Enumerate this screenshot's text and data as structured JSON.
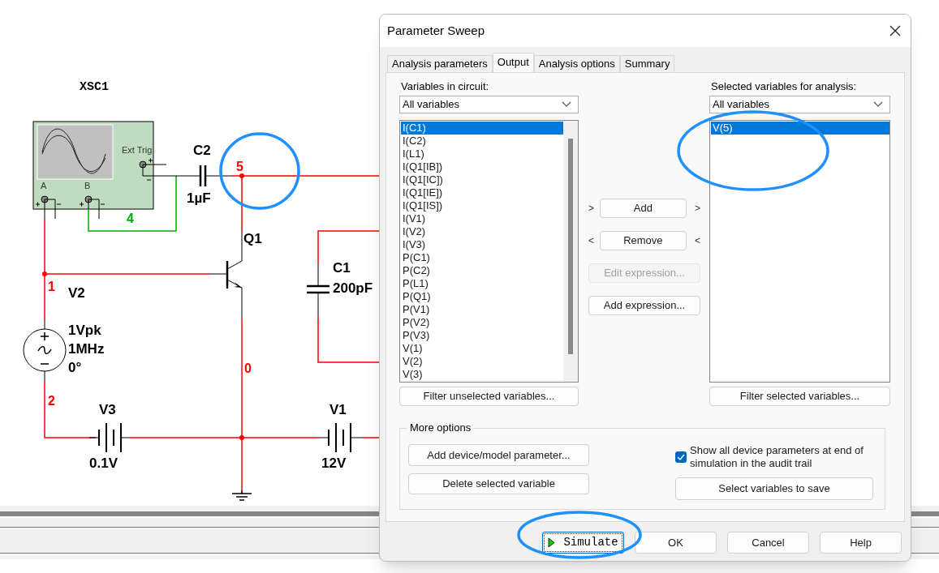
{
  "canvas": {
    "labels": [
      {
        "text": "XSC1",
        "kind": "instrument"
      },
      {
        "text": "Ext Trig",
        "kind": "pin"
      },
      {
        "text": "A",
        "kind": "pin"
      },
      {
        "text": "B",
        "kind": "pin"
      },
      {
        "text": "C2",
        "kind": "ref"
      },
      {
        "text": "1µF",
        "kind": "value"
      },
      {
        "text": "5",
        "kind": "node",
        "color": "#ff0000"
      },
      {
        "text": "4",
        "kind": "node",
        "color": "#00b000"
      },
      {
        "text": "Q1",
        "kind": "ref"
      },
      {
        "text": "C1",
        "kind": "ref"
      },
      {
        "text": "1",
        "kind": "node",
        "color": "#ff0000"
      },
      {
        "text": "V2",
        "kind": "ref"
      },
      {
        "text": "200pF",
        "kind": "value"
      },
      {
        "text": "1Vpk",
        "kind": "value"
      },
      {
        "text": "1MHz",
        "kind": "value"
      },
      {
        "text": "0°",
        "kind": "value"
      },
      {
        "text": "0",
        "kind": "node",
        "color": "#ff0000"
      },
      {
        "text": "2",
        "kind": "node",
        "color": "#ff0000"
      },
      {
        "text": "V3",
        "kind": "ref"
      },
      {
        "text": "0.1V",
        "kind": "value"
      },
      {
        "text": "V1",
        "kind": "ref"
      },
      {
        "text": "12V",
        "kind": "value"
      }
    ]
  },
  "dialog": {
    "title": "Parameter Sweep",
    "tabs": [
      {
        "label": "Analysis parameters",
        "selected": false
      },
      {
        "label": "Output",
        "selected": true
      },
      {
        "label": "Analysis options",
        "selected": false
      },
      {
        "label": "Summary",
        "selected": false
      }
    ],
    "left": {
      "label": "Variables in circuit:",
      "filter": "All variables",
      "button": "Filter unselected variables...",
      "items": [
        {
          "text": "I(C1)",
          "selected": true
        },
        {
          "text": "I(C2)",
          "selected": false
        },
        {
          "text": "I(L1)",
          "selected": false
        },
        {
          "text": "I(Q1[IB])",
          "selected": false
        },
        {
          "text": "I(Q1[IC])",
          "selected": false
        },
        {
          "text": "I(Q1[IE])",
          "selected": false
        },
        {
          "text": "I(Q1[IS])",
          "selected": false
        },
        {
          "text": "I(V1)",
          "selected": false
        },
        {
          "text": "I(V2)",
          "selected": false
        },
        {
          "text": "I(V3)",
          "selected": false
        },
        {
          "text": "P(C1)",
          "selected": false
        },
        {
          "text": "P(C2)",
          "selected": false
        },
        {
          "text": "P(L1)",
          "selected": false
        },
        {
          "text": "P(Q1)",
          "selected": false
        },
        {
          "text": "P(V1)",
          "selected": false
        },
        {
          "text": "P(V2)",
          "selected": false
        },
        {
          "text": "P(V3)",
          "selected": false
        },
        {
          "text": "V(1)",
          "selected": false
        },
        {
          "text": "V(2)",
          "selected": false
        },
        {
          "text": "V(3)",
          "selected": false
        }
      ]
    },
    "middle": [
      {
        "left": ">",
        "label": "Add",
        "right": ">",
        "disabled": false
      },
      {
        "left": "<",
        "label": "Remove",
        "right": "<",
        "disabled": false
      },
      {
        "label": "Edit expression...",
        "disabled": true
      },
      {
        "label": "Add expression...",
        "disabled": false
      }
    ],
    "right": {
      "label": "Selected variables for analysis:",
      "filter": "All variables",
      "button": "Filter selected variables...",
      "items": [
        {
          "text": "V(5)",
          "selected": true
        }
      ]
    },
    "more_options": {
      "title": "More options",
      "buttons": [
        "Add device/model parameter...",
        "Delete selected variable"
      ],
      "checkbox": {
        "label": "Show all device parameters at end of simulation in the audit trail",
        "checked": true
      },
      "save_button": "Select variables to save"
    },
    "buttons": [
      {
        "label": "Simulate",
        "kind": "simulate"
      },
      {
        "label": "OK",
        "kind": "plain"
      },
      {
        "label": "Cancel",
        "kind": "plain"
      },
      {
        "label": "Help",
        "kind": "plain"
      }
    ]
  }
}
